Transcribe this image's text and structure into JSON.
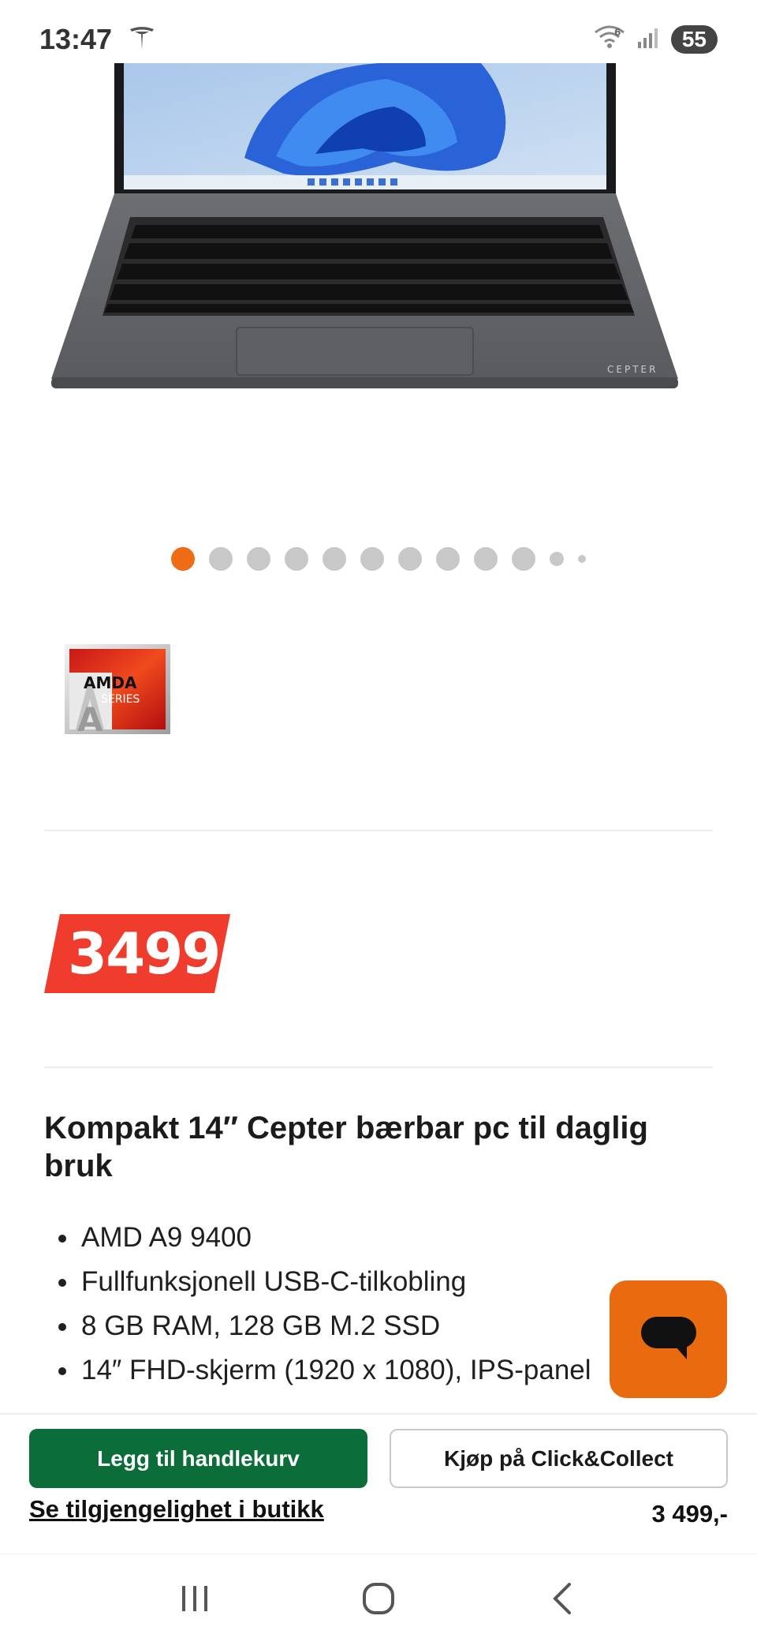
{
  "status_bar": {
    "time": "13:47",
    "battery_level": "55",
    "icons": [
      "tesla-icon",
      "wifi-6-icon",
      "signal-icon",
      "battery-icon"
    ]
  },
  "product": {
    "image_alt": "Cepter laptop",
    "laptop_brand_mark": "CEPTER",
    "carousel": {
      "total_slides": 12,
      "active_index": 0
    },
    "badge": {
      "brand": "AMDA",
      "series": "SERIES",
      "letter": "A"
    },
    "price_badge": "3499",
    "title": "Kompakt 14″ Cepter bærbar pc til daglig bruk",
    "specs": [
      "AMD A9 9400",
      "Fullfunksjonell USB-C-tilkobling",
      "8 GB RAM, 128 GB M.2 SSD",
      "14″ FHD-skjerm (1920 x 1080), IPS-panel"
    ]
  },
  "actions": {
    "add_to_cart": "Legg til handlekurv",
    "click_collect": "Kjøp på Click&Collect",
    "availability_link": "Se tilgjengelighet i butikk",
    "price": "3 499,-"
  },
  "colors": {
    "accent": "#ef6c16",
    "price_red": "#f03c2d",
    "cart_green": "#0b6e3a",
    "chat_orange": "#ea6a10"
  },
  "nav": {
    "icons": [
      "recent-apps-icon",
      "home-icon",
      "back-icon"
    ]
  }
}
